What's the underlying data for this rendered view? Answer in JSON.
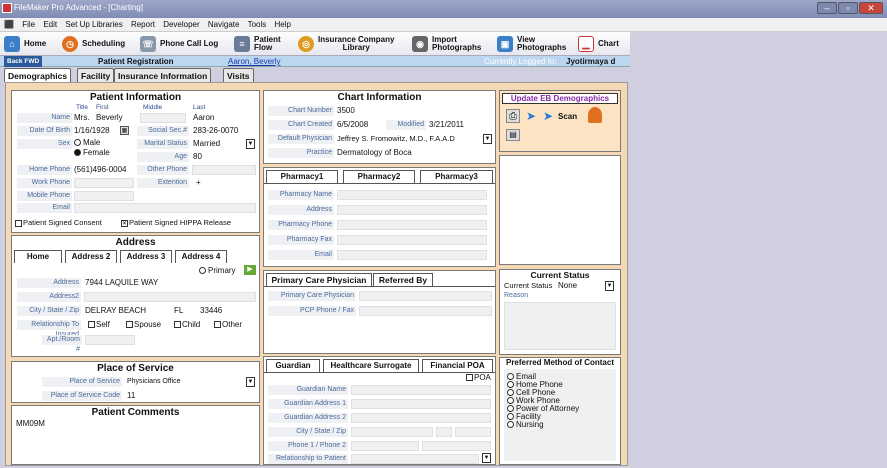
{
  "window": {
    "title": "FileMaker Pro Advanced - [Charting]"
  },
  "menu": [
    "File",
    "Edit",
    "Set Up Libraries",
    "Report",
    "Developer",
    "Navigate",
    "Tools",
    "Help"
  ],
  "toolbar": {
    "home": "Home",
    "scheduling": "Scheduling",
    "phone_call_log": "Phone Call Log",
    "patient_flow_1": "Patient",
    "patient_flow_2": "Flow",
    "ins_lib_1": "Insurance Company",
    "ins_lib_2": "Library",
    "import_1": "Import",
    "import_2": "Photographs",
    "view_1": "View",
    "view_2": "Photographs",
    "chart": "Chart"
  },
  "nav": {
    "back": "Back FWD",
    "screen": "Patient Registration",
    "patient": "Aaron, Beverly",
    "logged_in_label": "Currently Logged In:",
    "user": "Jyotirmaya d"
  },
  "tabs": [
    "Demographics",
    "Facility",
    "Insurance Information",
    "Visits"
  ],
  "patient_info": {
    "title": "Patient Information",
    "col_title": "Title",
    "col_first": "First",
    "col_middle": "Middle",
    "col_last": "Last",
    "name_label": "Name",
    "name_title": "Mrs.",
    "name_first": "Beverly",
    "name_last": "Aaron",
    "dob_label": "Date Of Birth",
    "dob": "1/16/1928",
    "ssn_label": "Social Sec.#",
    "ssn": "283-26-0070",
    "sex_label": "Sex",
    "sex_male": "Male",
    "sex_female": "Female",
    "marital_label": "Marital Status",
    "marital": "Married",
    "age_label": "Age",
    "age": "80",
    "home_phone_label": "Home Phone",
    "home_phone": "(561)496-0004",
    "other_phone_label": "Other Phone",
    "work_phone_label": "Work Phone",
    "extension_label": "Extention",
    "extension": "+",
    "mobile_label": "Mobile Phone",
    "email_label": "Email",
    "consent": "Patient Signed Consent",
    "hippa": "Patient Signed HIPPA Release"
  },
  "address": {
    "title": "Address",
    "tabs": [
      "Home",
      "Address 2",
      "Address 3",
      "Address 4"
    ],
    "primary": "Primary",
    "address_label": "Address",
    "address": "7944 LAQUILE WAY",
    "address2_label": "Address2",
    "csz_label": "City / State / Zip",
    "city": "DELRAY BEACH",
    "state": "FL",
    "zip": "33446",
    "rel_label": "Relationship To Insured",
    "rel_self": "Self",
    "rel_spouse": "Spouse",
    "rel_child": "Child",
    "rel_other": "Other",
    "apt_label": "Apt./Room #"
  },
  "place_of_service": {
    "title": "Place of Service",
    "pos_label": "Place of Service",
    "pos": "Physicians Office",
    "code_label": "Place of Service Code",
    "code": "11"
  },
  "comments": {
    "title": "Patient Comments",
    "text": "MM09M"
  },
  "chart_info": {
    "title": "Chart Information",
    "number_label": "Chart Number",
    "number": "3500",
    "created_label": "Chart Created",
    "created": "6/5/2008",
    "modified_label": "Modified",
    "modified": "3/21/2011",
    "physician_label": "Default Physician",
    "physician": "Jeffrey S. Fromowitz, M.D., F.A.A.D",
    "practice_label": "Practice",
    "practice": "Dermatology of Boca"
  },
  "pharmacy": {
    "tabs": [
      "Pharmacy1",
      "Pharmacy2",
      "Pharmacy3"
    ],
    "fields": [
      "Pharmacy Name",
      "Address",
      "Pharmacy Phone",
      "Pharmacy Fax",
      "Email"
    ]
  },
  "pcp": {
    "tabs": [
      "Primary Care Physician",
      "Referred By"
    ],
    "pcp_label": "Primary Care Physician",
    "phone_label": "PCP Phone / Fax"
  },
  "guardian": {
    "tabs": [
      "Guardian",
      "Healthcare Surrogate",
      "Financial POA"
    ],
    "poa": "POA",
    "fields": [
      "Guardian Name",
      "Guardian Address 1",
      "Guardian Address 2",
      "City / State / Zip",
      "Phone 1 / Phone 2",
      "Relationship to Patient"
    ]
  },
  "eb": {
    "title": "Update EB Demographics",
    "scan": "Scan"
  },
  "status": {
    "title": "Current Status",
    "label": "Current Status",
    "value": "None",
    "reason": "Reason"
  },
  "contact": {
    "title": "Preferred Method of Contact",
    "options": [
      "Email",
      "Home Phone",
      "Cell Phone",
      "Work Phone",
      "Power of Attorney",
      "Facility",
      "Nursing"
    ]
  }
}
